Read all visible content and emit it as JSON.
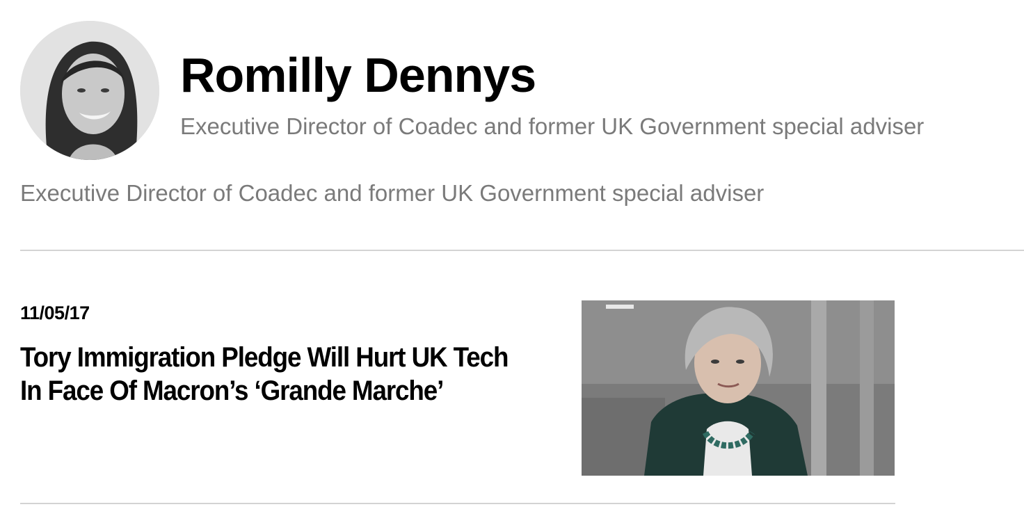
{
  "author": {
    "name": "Romilly Dennys",
    "title": "Executive Director of Coadec and former UK Government special adviser",
    "bio": "Executive Director of Coadec and former UK Government special adviser"
  },
  "articles": [
    {
      "date": "11/05/17",
      "headline": "Tory Immigration Pledge Will Hurt UK Tech In Face Of Macron’s ‘Grande Marche’",
      "image_icon": "photo-thumbnail"
    }
  ],
  "colors": {
    "secondary_text": "#7a7a7a",
    "divider": "#d3d3d3"
  }
}
